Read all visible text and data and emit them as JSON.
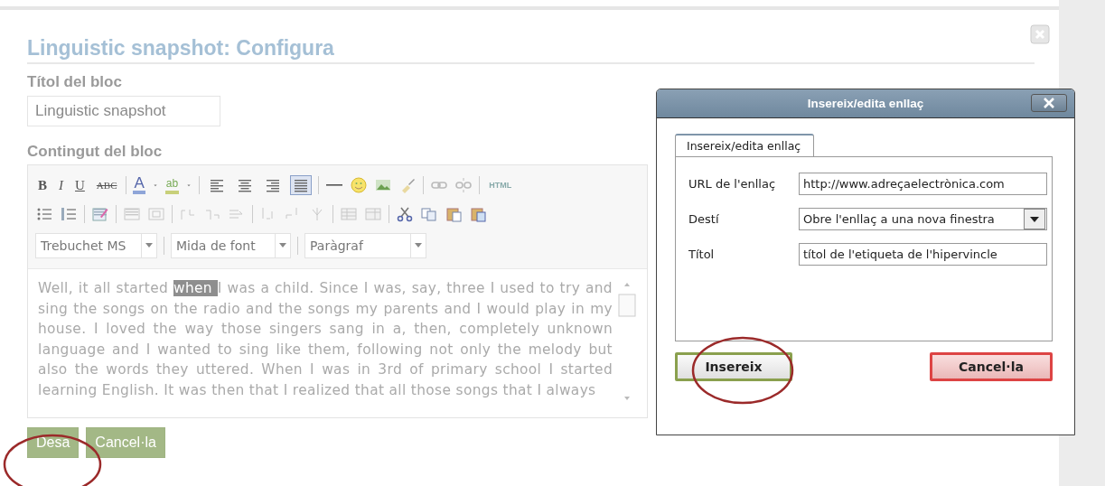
{
  "page": {
    "title": "Linguistic snapshot: Configura",
    "block_title_label": "Títol del bloc",
    "block_title_value": "Linguistic snapshot",
    "content_label": "Contingut del bloc"
  },
  "toolbar": {
    "format_buttons": [
      {
        "label": "B"
      },
      {
        "label": "I"
      },
      {
        "label": "U"
      },
      {
        "label": "ABC"
      }
    ],
    "color_buttons": [
      {
        "label": "A"
      },
      {
        "label": "ab"
      }
    ],
    "align_buttons": [
      {
        "selected": false
      },
      {
        "selected": false
      },
      {
        "selected": false
      },
      {
        "selected": true
      }
    ],
    "html_button": {
      "label": "HTML"
    },
    "dropdowns": [
      {
        "value": "Trebuchet MS"
      },
      {
        "value": "Mida de font"
      },
      {
        "value": "Paràgraf"
      }
    ]
  },
  "editor": {
    "text_before": "Well, it all started ",
    "selected_text": "when ",
    "text_after": "I was a child. Since I was, say, three I used to try and sing the songs on the radio and the songs my parents and I would play in my house. I loved the way those singers sang in a, then, completely unknown language and I wanted to sing like them, following not only the melody but also the words they uttered. When I was in 3rd of primary school I started learning English. It was then that I realized that all those songs that I always"
  },
  "buttons": [
    {
      "label": "Desa"
    },
    {
      "label": "Cancel·la"
    }
  ],
  "dialog": {
    "title": "Insereix/edita enllaç",
    "tabs": [
      {
        "label": "Insereix/edita enllaç",
        "selected": true
      }
    ],
    "fields": [
      {
        "kind": "text",
        "label": "URL de l'enllaç",
        "value": "http://www.adreçaelectrònica.com"
      },
      {
        "kind": "select",
        "label": "Destí",
        "value": "Obre l'enllaç a una nova finestra"
      },
      {
        "kind": "text",
        "label": "Títol",
        "value": "títol de l'etiqueta de l'hipervincle"
      }
    ],
    "buttons": [
      {
        "kind": "insert",
        "label": "Insereix"
      },
      {
        "kind": "cancel",
        "label": "Cancel·la"
      }
    ]
  }
}
